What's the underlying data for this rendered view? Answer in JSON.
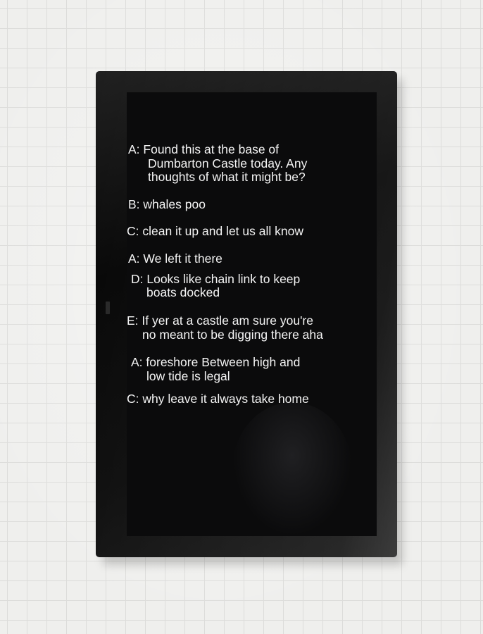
{
  "conversation": [
    "A:  Found this at the base of",
    "Dumbarton Castle today. Any",
    "thoughts of what it might be?",
    "B: whales poo",
    "C: clean it up and let us all know",
    "A: We left it there",
    "D: Looks like chain link to keep",
    "boats docked",
    "E: If yer at a castle am sure you're",
    "no meant to be digging there aha",
    "A: foreshore Between high and",
    "low tide is legal",
    "C: why leave it always take home"
  ],
  "colors": {
    "wall": "#efefed",
    "frame": "#070707",
    "screen": "#0b0b0c",
    "text": "#f4f4f4"
  }
}
